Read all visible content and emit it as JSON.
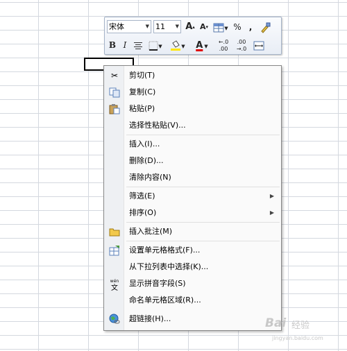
{
  "mini_toolbar": {
    "font_name": "宋体",
    "font_size": "11",
    "grow_font": "A",
    "shrink_font": "A",
    "percent": "%",
    "comma": ",",
    "bold": "B",
    "italic": "I",
    "font_color_letter": "A",
    "increase_decimal": "+.0 .00",
    "decrease_decimal": ".00 →.0"
  },
  "menu": {
    "items": [
      {
        "label": "剪切(T)"
      },
      {
        "label": "复制(C)"
      },
      {
        "label": "粘贴(P)"
      },
      {
        "label": "选择性粘贴(V)..."
      },
      {
        "label": "插入(I)..."
      },
      {
        "label": "删除(D)..."
      },
      {
        "label": "清除内容(N)"
      },
      {
        "label": "筛选(E)"
      },
      {
        "label": "排序(O)"
      },
      {
        "label": "插入批注(M)"
      },
      {
        "label": "设置单元格格式(F)..."
      },
      {
        "label": "从下拉列表中选择(K)..."
      },
      {
        "label": "显示拼音字段(S)"
      },
      {
        "label": "命名单元格区域(R)..."
      },
      {
        "label": "超链接(H)..."
      }
    ]
  },
  "watermark": {
    "brand": "Bai",
    "name": "经验",
    "url": "jingyan.baidu.com"
  },
  "colors": {
    "highlight": "#ffe600",
    "font_color": "#e00000"
  }
}
